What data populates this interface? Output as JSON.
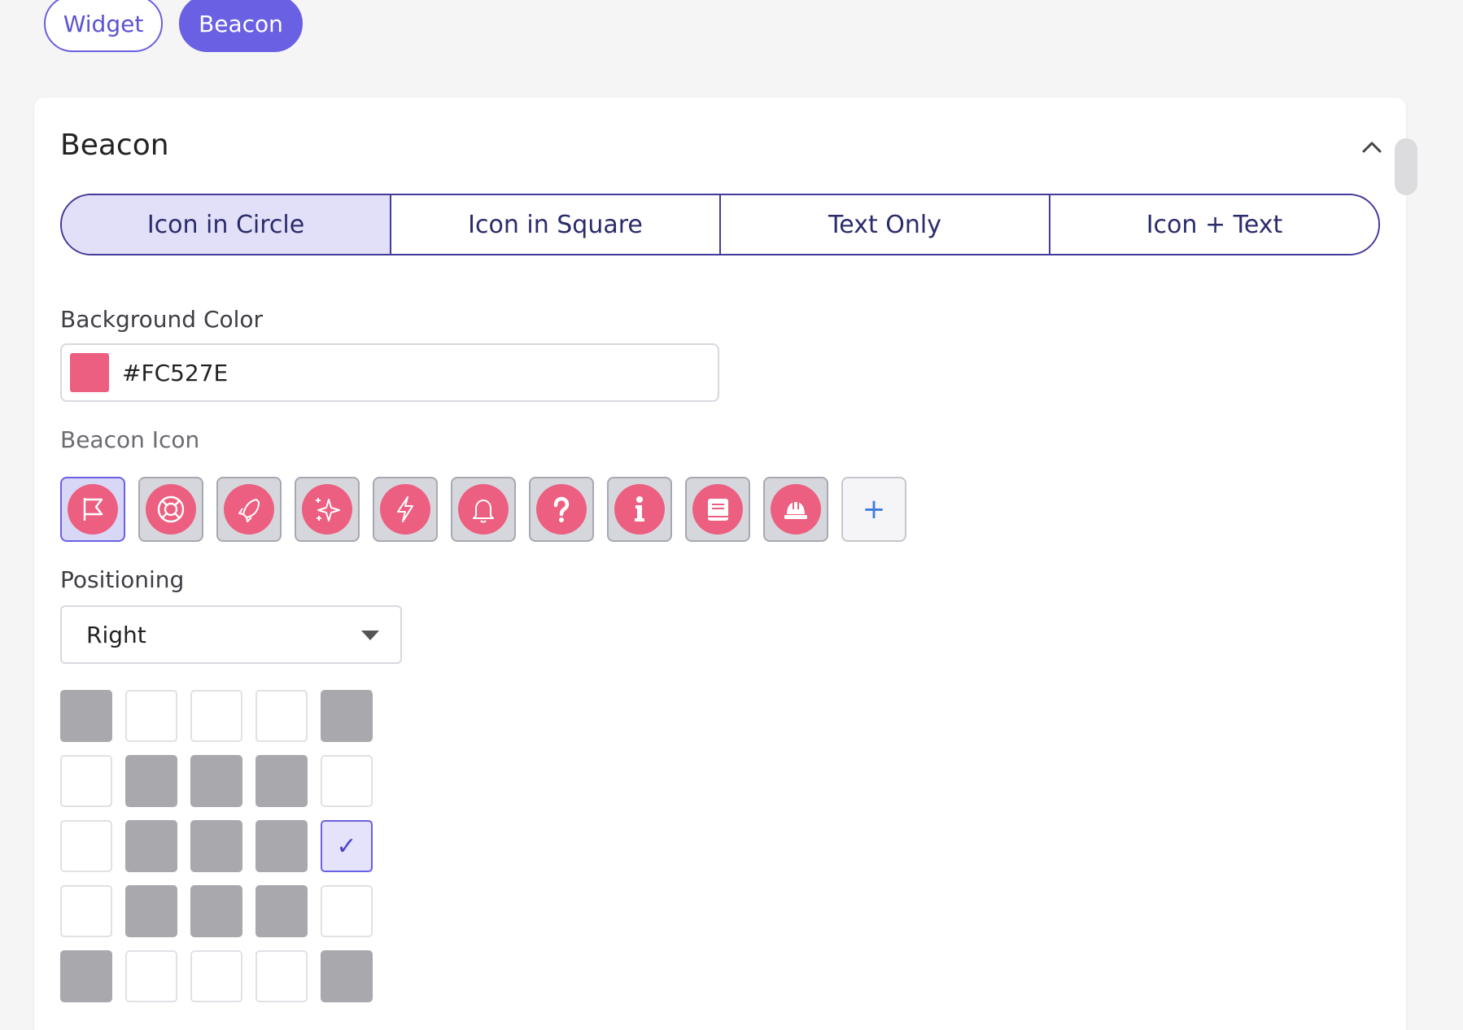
{
  "top_tabs": [
    {
      "label": "Widget",
      "active": false
    },
    {
      "label": "Beacon",
      "active": true
    }
  ],
  "card": {
    "title": "Beacon",
    "style_tabs": [
      {
        "label": "Icon in Circle",
        "active": true
      },
      {
        "label": "Icon in Square",
        "active": false
      },
      {
        "label": "Text Only",
        "active": false
      },
      {
        "label": "Icon + Text",
        "active": false
      }
    ],
    "background_color": {
      "label": "Background Color",
      "value": "#FC527E",
      "swatch": "#ec5f80"
    },
    "beacon_icon": {
      "label": "Beacon Icon",
      "icons": [
        "flag-icon",
        "lifebuoy-icon",
        "rocket-icon",
        "sparkle-icon",
        "lightning-icon",
        "bell-icon",
        "question-icon",
        "info-icon",
        "book-icon",
        "hard-hat-icon"
      ],
      "selected": "flag-icon",
      "add_label": "+"
    },
    "positioning": {
      "label": "Positioning",
      "value": "Right",
      "check_mark": "✓",
      "grid": [
        [
          "disabled",
          "open",
          "open",
          "open",
          "disabled"
        ],
        [
          "open",
          "disabled",
          "disabled",
          "disabled",
          "open"
        ],
        [
          "open",
          "disabled",
          "disabled",
          "disabled",
          "selected"
        ],
        [
          "open",
          "disabled",
          "disabled",
          "disabled",
          "open"
        ],
        [
          "disabled",
          "open",
          "open",
          "open",
          "disabled"
        ]
      ]
    }
  },
  "colors": {
    "accent": "#6a60e4",
    "beacon_pink": "#ec5f80",
    "disabled_cell": "#a8a8ad"
  }
}
